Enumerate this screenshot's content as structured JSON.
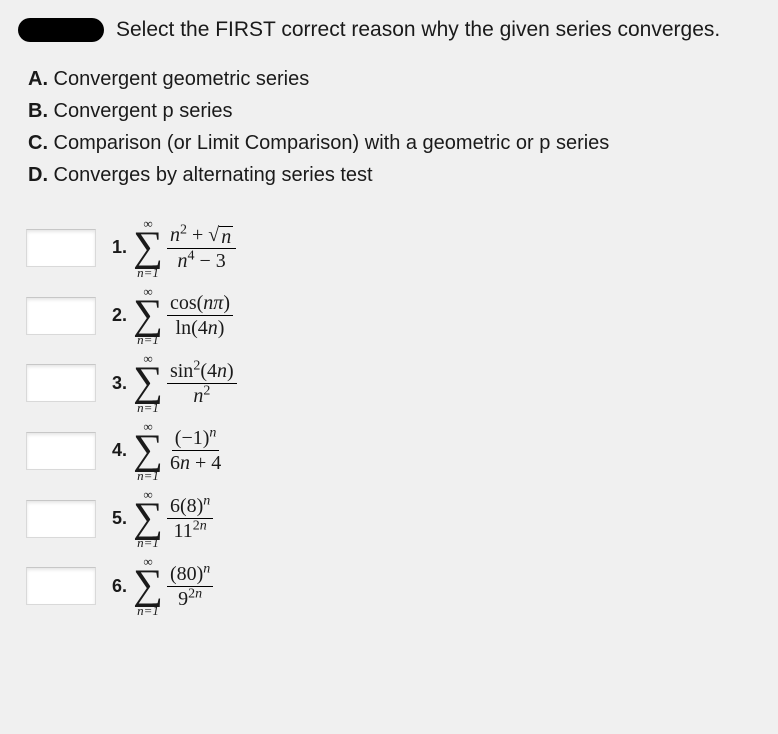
{
  "prompt": "Select the FIRST correct reason why the given series converges.",
  "options": [
    {
      "letter": "A.",
      "text": "Convergent geometric series"
    },
    {
      "letter": "B.",
      "text": "Convergent p series"
    },
    {
      "letter": "C.",
      "text": "Comparison (or Limit Comparison) with a geometric or p series"
    },
    {
      "letter": "D.",
      "text": "Converges by alternating series test"
    }
  ],
  "sigma": {
    "top": "∞",
    "symbol": "∑",
    "bottom": "n=1"
  },
  "questions": [
    {
      "number": "1.",
      "num_html": "<span class='it'>n</span><span class='sup'>2</span> + <span class='sqrt'><span class='sqrt-body'><span class='it'>n</span></span></span>",
      "den_html": "<span class='it'>n</span><span class='sup'>4</span> − 3"
    },
    {
      "number": "2.",
      "num_html": "cos(<span class='it'>nπ</span>)",
      "den_html": "ln(4<span class='it'>n</span>)"
    },
    {
      "number": "3.",
      "num_html": "sin<span class='sup'>2</span>(4<span class='it'>n</span>)",
      "den_html": "<span class='it'>n</span><span class='sup'>2</span>"
    },
    {
      "number": "4.",
      "num_html": "(−1)<span class='sup'><span class='it'>n</span></span>",
      "den_html": "6<span class='it'>n</span> + 4"
    },
    {
      "number": "5.",
      "num_html": "6(8)<span class='sup'><span class='it'>n</span></span>",
      "den_html": "11<span class='sup'>2<span class='it'>n</span></span>"
    },
    {
      "number": "6.",
      "num_html": "(80)<span class='sup'><span class='it'>n</span></span>",
      "den_html": "9<span class='sup'>2<span class='it'>n</span></span>"
    }
  ]
}
